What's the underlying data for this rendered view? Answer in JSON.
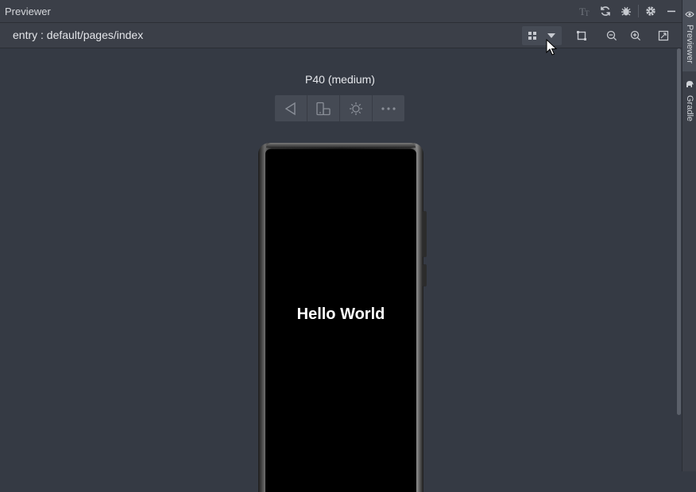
{
  "window": {
    "title": "Previewer"
  },
  "titlebar_icons": [
    "font-size-icon",
    "refresh-icon",
    "debug-icon",
    "gear-icon",
    "minimize-icon"
  ],
  "toolbar": {
    "path": "entry : default/pages/index",
    "buttons": [
      "multi-device-icon",
      "dropdown-arrow-icon",
      "crop-icon",
      "zoom-out-icon",
      "zoom-in-icon",
      "fit-screen-icon"
    ]
  },
  "device": {
    "name": "P40 (medium)",
    "controls": [
      "back-icon",
      "rotate-icon",
      "brightness-icon",
      "more-icon"
    ],
    "screen_text": "Hello World"
  },
  "side_tabs": [
    {
      "label": "Previewer",
      "icon": "eye-icon",
      "active": true
    },
    {
      "label": "Gradle",
      "icon": "elephant-icon",
      "active": false
    }
  ],
  "colors": {
    "background": "#353a44",
    "panel": "#3b3f48",
    "phone_screen": "#000000",
    "text": "#e6e8ec"
  }
}
